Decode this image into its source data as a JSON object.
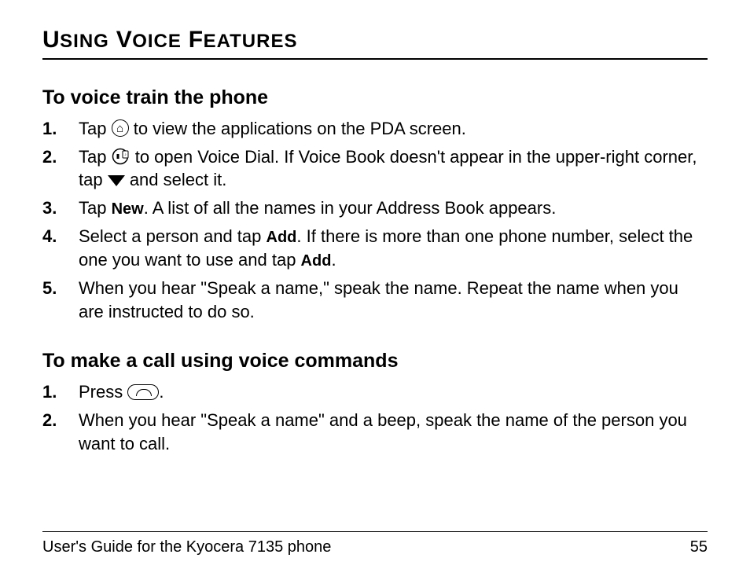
{
  "title": {
    "word1_cap": "U",
    "word1_rest": "SING",
    "word2_cap": "V",
    "word2_rest": "OICE",
    "word3_cap": "F",
    "word3_rest": "EATURES"
  },
  "section1": {
    "heading": "To voice train the phone",
    "steps": [
      {
        "pre": "Tap ",
        "icon": "home",
        "post": " to view the applications on the PDA screen."
      },
      {
        "pre": "Tap ",
        "icon": "voice-dial",
        "mid": " to open Voice Dial. If Voice Book doesn't appear in the upper-right corner, tap ",
        "icon2": "down-tri",
        "post": " and select it."
      },
      {
        "pre": "Tap ",
        "bold": "New",
        "post": ". A list of all the names in your Address Book appears."
      },
      {
        "pre": "Select a person and tap ",
        "bold": "Add",
        "mid": ". If there is more than one phone number, select the one you want to use and tap ",
        "bold2": "Add",
        "post": "."
      },
      {
        "full": "When you hear \"Speak a name,\" speak the name. Repeat the name when you are instructed to do so."
      }
    ]
  },
  "section2": {
    "heading": "To make a call using voice commands",
    "steps": [
      {
        "pre": "Press ",
        "icon": "call-key",
        "post": "."
      },
      {
        "full": "When you hear \"Speak a name\" and a beep, speak the name of the person you want to call."
      }
    ]
  },
  "footer": {
    "left": "User's Guide for the Kyocera 7135 phone",
    "right": "55"
  }
}
